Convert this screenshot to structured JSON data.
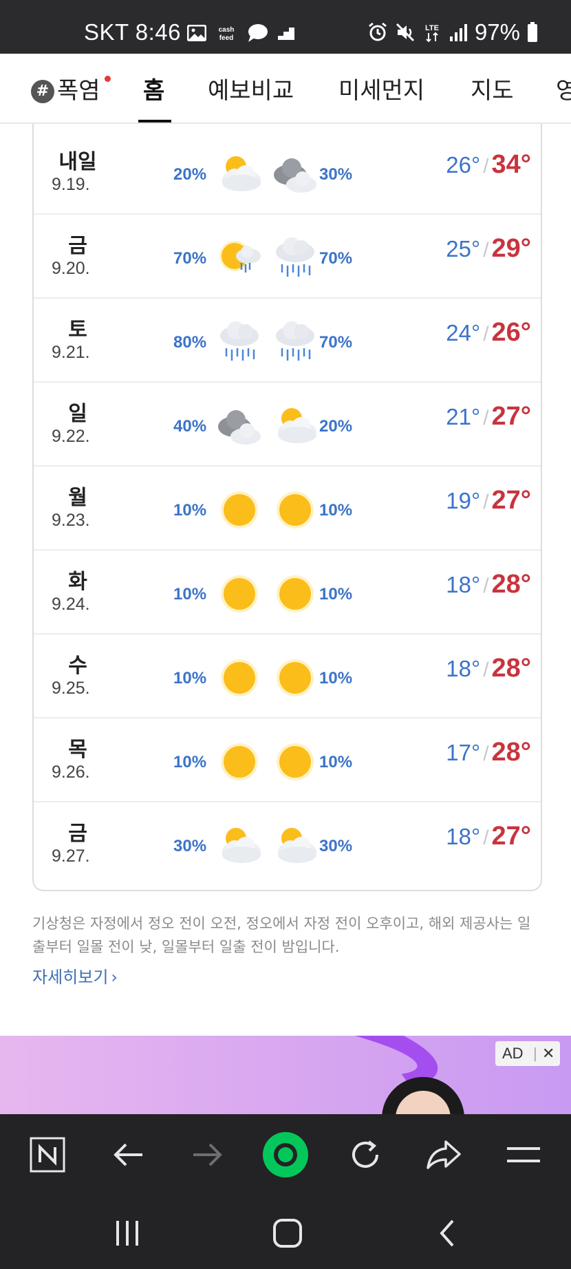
{
  "status_bar": {
    "carrier_time": "SKT 8:46",
    "left_icons": [
      "gallery-icon",
      "cashfeed-icon",
      "chat-bubble-icon",
      "stairs-icon"
    ],
    "cashfeed_text": "cash\nfeed",
    "right_icons": [
      "alarm-icon",
      "mute-icon",
      "lte-icon",
      "signal-icon"
    ],
    "lte_label": "LTE",
    "battery": "97%"
  },
  "tabs": [
    {
      "label": "폭염",
      "hash": "#",
      "has_dot": true
    },
    {
      "label": "홈",
      "active": true
    },
    {
      "label": "예보비교"
    },
    {
      "label": "미세먼지"
    },
    {
      "label": "지도"
    },
    {
      "label": "영"
    }
  ],
  "forecast": [
    {
      "day": "내일",
      "date": "9.19.",
      "am_pct": "20%",
      "am_icon": "partly-cloudy-icon",
      "pm_icon": "cloudy-icon",
      "pm_pct": "30%",
      "min": "26°",
      "max": "34°"
    },
    {
      "day": "금",
      "date": "9.20.",
      "am_pct": "70%",
      "am_icon": "sun-rain-icon",
      "pm_icon": "rain-icon",
      "pm_pct": "70%",
      "min": "25°",
      "max": "29°"
    },
    {
      "day": "토",
      "date": "9.21.",
      "am_pct": "80%",
      "am_icon": "rain-icon",
      "pm_icon": "rain-icon",
      "pm_pct": "70%",
      "min": "24°",
      "max": "26°"
    },
    {
      "day": "일",
      "date": "9.22.",
      "am_pct": "40%",
      "am_icon": "cloudy-icon",
      "pm_icon": "partly-cloudy-icon",
      "pm_pct": "20%",
      "min": "21°",
      "max": "27°"
    },
    {
      "day": "월",
      "date": "9.23.",
      "am_pct": "10%",
      "am_icon": "sunny-icon",
      "pm_icon": "sunny-icon",
      "pm_pct": "10%",
      "min": "19°",
      "max": "27°"
    },
    {
      "day": "화",
      "date": "9.24.",
      "am_pct": "10%",
      "am_icon": "sunny-icon",
      "pm_icon": "sunny-icon",
      "pm_pct": "10%",
      "min": "18°",
      "max": "28°"
    },
    {
      "day": "수",
      "date": "9.25.",
      "am_pct": "10%",
      "am_icon": "sunny-icon",
      "pm_icon": "sunny-icon",
      "pm_pct": "10%",
      "min": "18°",
      "max": "28°"
    },
    {
      "day": "목",
      "date": "9.26.",
      "am_pct": "10%",
      "am_icon": "sunny-icon",
      "pm_icon": "sunny-icon",
      "pm_pct": "10%",
      "min": "17°",
      "max": "28°"
    },
    {
      "day": "금",
      "date": "9.27.",
      "am_pct": "30%",
      "am_icon": "partly-cloudy-icon",
      "pm_icon": "partly-cloudy-icon",
      "pm_pct": "30%",
      "min": "18°",
      "max": "27°"
    }
  ],
  "slash": "/",
  "note": "기상청은 자정에서 정오 전이 오전, 정오에서 자정 전이 오후이고, 해외 제공사는 일출부터 일몰 전이 낮, 일몰부터 일출 전이 밤입니다.",
  "more_link": "자세히보기",
  "more_chevron": "›",
  "ad": {
    "badge": "AD",
    "close": "✕"
  },
  "browser_bar": [
    "naver-n-icon",
    "back-arrow-icon",
    "forward-arrow-icon",
    "green-dot-home-icon",
    "refresh-icon",
    "share-icon",
    "menu-icon"
  ],
  "nav_bar": [
    "recent-apps-icon",
    "home-icon",
    "back-icon"
  ],
  "colors": {
    "min_temp": "#3b73c8",
    "max_temp": "#c8343e",
    "precip": "#3b73c8",
    "accent_green": "#03c75a"
  }
}
